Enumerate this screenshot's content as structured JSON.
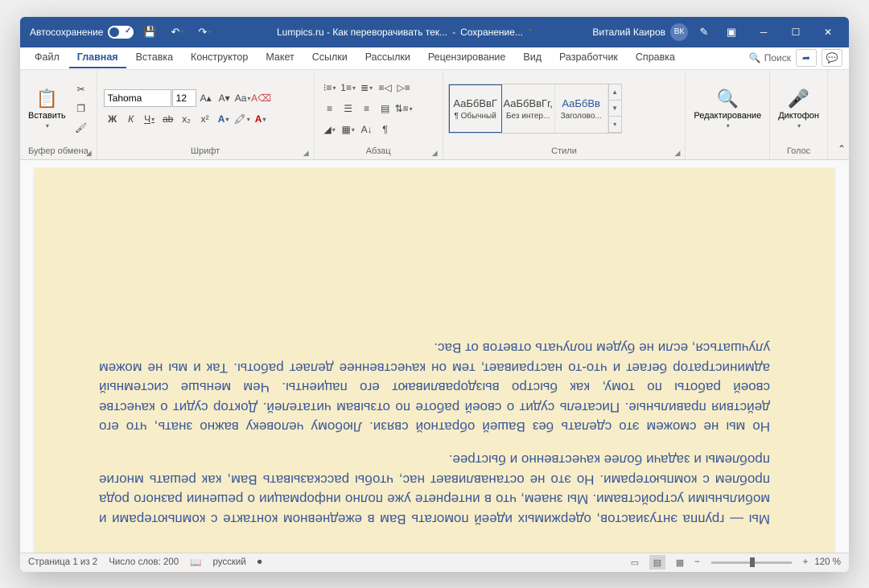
{
  "titlebar": {
    "autosave_label": "Автосохранение",
    "doc_title": "Lumpics.ru - Как переворачивать тек...",
    "save_status": "Сохранение...",
    "user_name": "Виталий Каиров",
    "user_initials": "ВК"
  },
  "tabs": {
    "file": "Файл",
    "home": "Главная",
    "insert": "Вставка",
    "design": "Конструктор",
    "layout": "Макет",
    "references": "Ссылки",
    "mailings": "Рассылки",
    "review": "Рецензирование",
    "view": "Вид",
    "developer": "Разработчик",
    "help": "Справка",
    "search": "Поиск"
  },
  "ribbon": {
    "clipboard": {
      "label": "Буфер обмена",
      "paste": "Вставить"
    },
    "font": {
      "label": "Шрифт",
      "name": "Tahoma",
      "size": "12",
      "bold": "Ж",
      "italic": "К",
      "underline": "Ч",
      "strike": "ab",
      "sub": "x₂",
      "sup": "x²"
    },
    "paragraph": {
      "label": "Абзац"
    },
    "styles": {
      "label": "Стили",
      "items": [
        {
          "preview": "АаБбВвГ",
          "name": "¶ Обычный"
        },
        {
          "preview": "АаБбВвГг,",
          "name": "Без интер..."
        },
        {
          "preview": "АаБбВв",
          "name": "Заголово..."
        }
      ]
    },
    "editing": {
      "label": "Редактирование"
    },
    "voice": {
      "label": "Голос",
      "dictate": "Диктофон"
    }
  },
  "document": {
    "para1": "Мы — группа энтузиастов, одержимых идеей помогать Вам в ежедневном контакте с компьютерами и мобильными устройствами. Мы знаем, что в интернете уже полно информации о решении разного рода проблем с компьютерами. Но это не останавливает нас, чтобы рассказывать Вам, как решать многие проблемы и задачи более качественно и быстрее.",
    "para2": "Но мы не сможем это сделать без Вашей обратной связи. Любому человеку важно знать, что его действия правильные. Писатель судит о своей работе по отзывам читателей. Доктор судит о качестве своей работы по тому, как быстро выздоравливают его пациенты. Чем меньше системный администратор бегает и что-то настраивает, тем он качественнее делает работы. Так и мы не можем улучшаться, если не будем получать ответов от Вас."
  },
  "statusbar": {
    "page": "Страница 1 из 2",
    "words": "Число слов: 200",
    "language": "русский",
    "zoom": "120 %"
  }
}
